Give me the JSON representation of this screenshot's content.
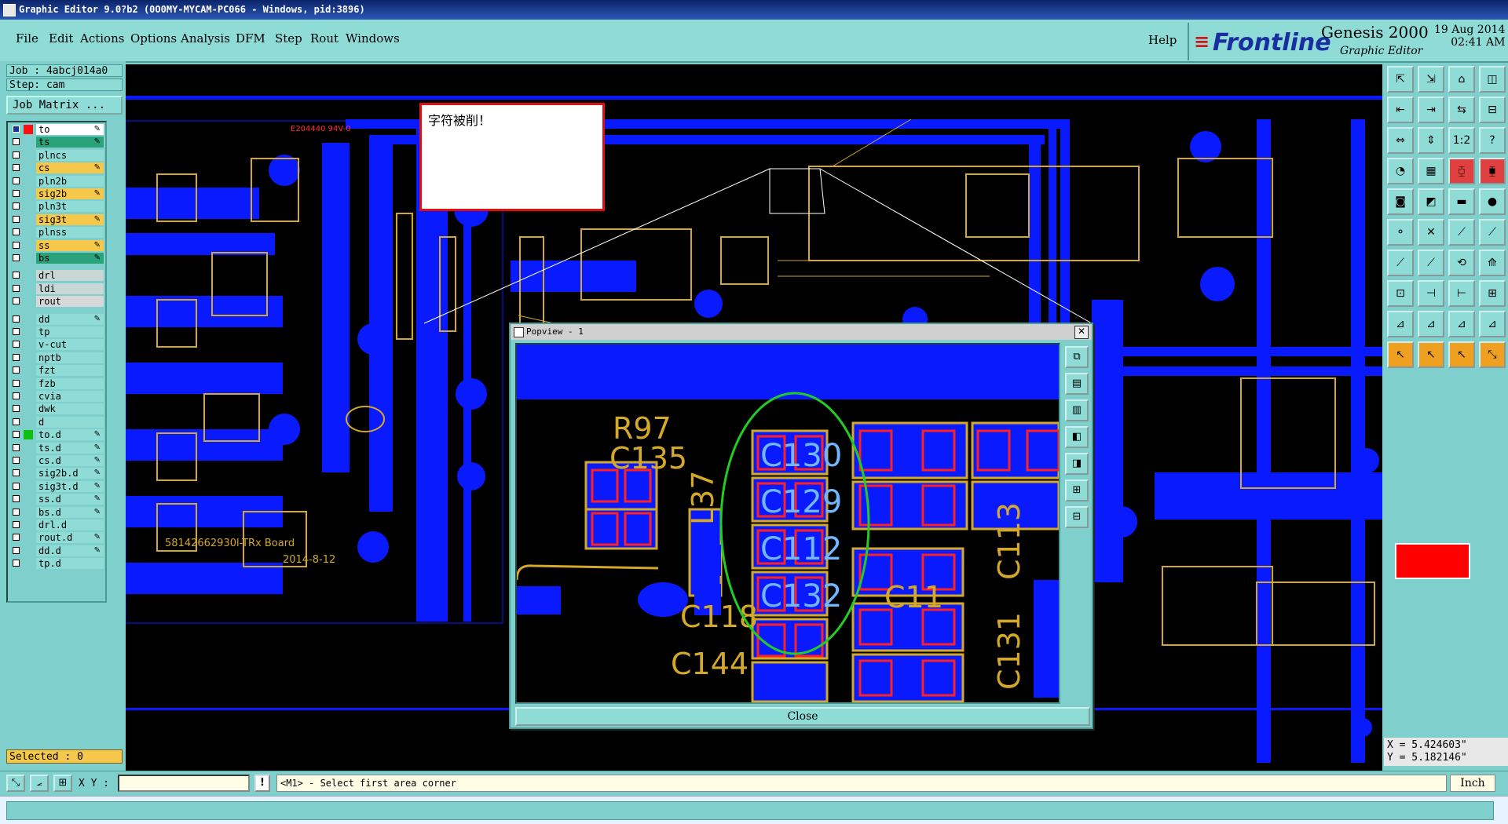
{
  "window": {
    "title": "Graphic Editor 9.0?b2 (0O0MY-MYCAM-PC066 - Windows, pid:3896)"
  },
  "menu": {
    "items": [
      "File",
      "Edit",
      "Actions",
      "Options",
      "Analysis",
      "DFM",
      "Step",
      "Rout",
      "Windows"
    ],
    "help": "Help"
  },
  "brand": {
    "logo": "Frontline",
    "product": "Genesis 2000",
    "subtitle": "Graphic Editor",
    "date": "19 Aug 2014",
    "time": "02:41 AM"
  },
  "left": {
    "job": "Job : 4abcj014a0",
    "step": "Step: cam",
    "job_matrix": "Job Matrix ...",
    "selected": "Selected : 0",
    "layers": [
      {
        "name": "to",
        "color": "#ffffff",
        "lock": true
      },
      {
        "name": "ts",
        "color": "#2aa27a",
        "lock": true
      },
      {
        "name": "plncs",
        "color": "#8fdcd7",
        "lock": false
      },
      {
        "name": "cs",
        "color": "#f5c74a",
        "lock": true
      },
      {
        "name": "pln2b",
        "color": "#8fdcd7",
        "lock": false
      },
      {
        "name": "sig2b",
        "color": "#f5c74a",
        "lock": true
      },
      {
        "name": "pln3t",
        "color": "#8fdcd7",
        "lock": false
      },
      {
        "name": "sig3t",
        "color": "#f5c74a",
        "lock": true
      },
      {
        "name": "plnss",
        "color": "#8fdcd7",
        "lock": false
      },
      {
        "name": "ss",
        "color": "#f5c74a",
        "lock": true
      },
      {
        "name": "bs",
        "color": "#2aa27a",
        "lock": true
      },
      {
        "name": "drl",
        "color": "#c8d6d6",
        "lock": false
      },
      {
        "name": "ldi",
        "color": "#c8d6d6",
        "lock": false
      },
      {
        "name": "rout",
        "color": "#d8d8d8",
        "lock": false
      },
      {
        "name": "dd",
        "color": "#8fdcd7",
        "lock": true
      },
      {
        "name": "tp",
        "color": "#8fdcd7",
        "lock": false
      },
      {
        "name": "v-cut",
        "color": "#8fdcd7",
        "lock": false
      },
      {
        "name": "nptb",
        "color": "#8fdcd7",
        "lock": false
      },
      {
        "name": "fzt",
        "color": "#8fdcd7",
        "lock": false
      },
      {
        "name": "fzb",
        "color": "#8fdcd7",
        "lock": false
      },
      {
        "name": "cvia",
        "color": "#8fdcd7",
        "lock": false
      },
      {
        "name": "dwk",
        "color": "#8fdcd7",
        "lock": false
      },
      {
        "name": "d",
        "color": "#8fdcd7",
        "lock": false
      },
      {
        "name": "to.d",
        "color": "#8fdcd7",
        "lock": true
      },
      {
        "name": "ts.d",
        "color": "#8fdcd7",
        "lock": true
      },
      {
        "name": "cs.d",
        "color": "#8fdcd7",
        "lock": true
      },
      {
        "name": "sig2b.d",
        "color": "#8fdcd7",
        "lock": true
      },
      {
        "name": "sig3t.d",
        "color": "#8fdcd7",
        "lock": true
      },
      {
        "name": "ss.d",
        "color": "#8fdcd7",
        "lock": true
      },
      {
        "name": "bs.d",
        "color": "#8fdcd7",
        "lock": true
      },
      {
        "name": "drl.d",
        "color": "#8fdcd7",
        "lock": false
      },
      {
        "name": "rout.d",
        "color": "#8fdcd7",
        "lock": true
      },
      {
        "name": "dd.d",
        "color": "#8fdcd7",
        "lock": true
      },
      {
        "name": "tp.d",
        "color": "#8fdcd7",
        "lock": false
      }
    ]
  },
  "canvas": {
    "note": "字符被削！",
    "board_label": "58142662930l-TRx Board",
    "board_date": "2014-8-12",
    "logo_marking": "E204440 94V-0"
  },
  "popview": {
    "title": "Popview - 1",
    "close": "Close",
    "refdes": [
      "R97",
      "C135",
      "L37",
      "C130",
      "C129",
      "C112",
      "C132",
      "C118",
      "C144",
      "C11",
      "C131",
      "C113"
    ]
  },
  "coords": {
    "x": "X = 5.424603\"",
    "y": "Y = 5.182146\""
  },
  "bottom": {
    "xy_label": "X Y :",
    "xy_value": "",
    "prompt": "<M1> - Select first area corner",
    "units": "Inch"
  },
  "colors": {
    "bg": "#7fd0cc",
    "copper": "#0a1aff",
    "silk": "#c8a040",
    "outline": "#ff2020",
    "highlight": "#22cc22"
  }
}
